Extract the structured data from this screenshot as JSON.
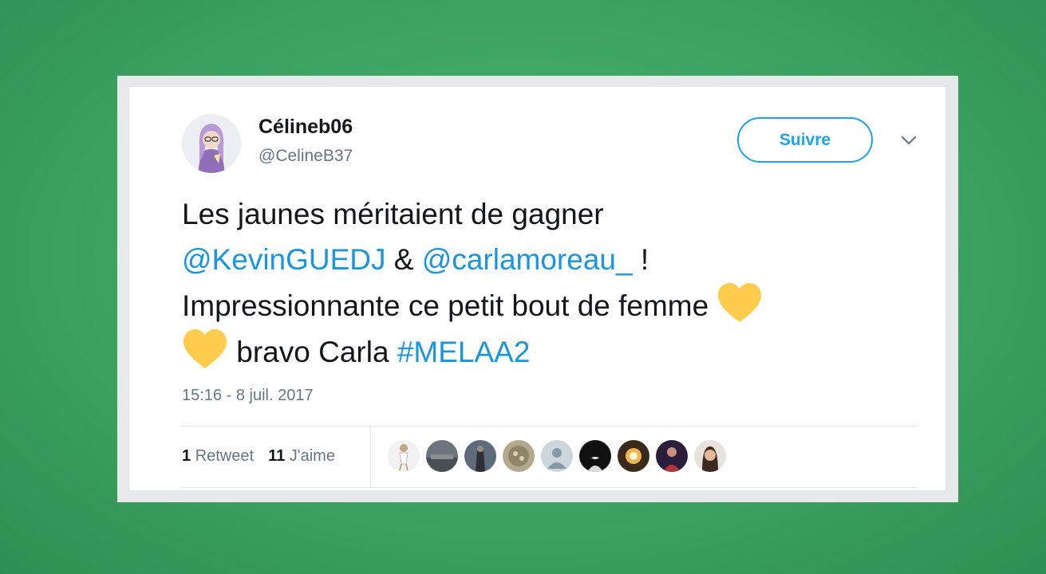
{
  "user": {
    "display_name": "Célineb06",
    "handle": "@CelineB37"
  },
  "follow_label": "Suivre",
  "tweet": {
    "line1": "Les jaunes méritaient de gagner",
    "mention1": "@KevinGUEDJ",
    "amp": " & ",
    "mention2": "@carlamoreau_",
    "excl": " !",
    "line3": "Impressionnante ce petit bout de femme ",
    "bravo": " bravo Carla ",
    "hashtag": "#MELAA2"
  },
  "timestamp": "15:16 - 8 juil. 2017",
  "stats": {
    "retweets_count": "1",
    "retweets_label": "Retweet",
    "likes_count": "11",
    "likes_label": "J'aime"
  },
  "colors": {
    "link": "#1b95e0",
    "heart": "#ffcc4d",
    "follow": "#1da1f2"
  },
  "icons": {
    "caret": "chevron-down-icon",
    "heart": "yellow-heart-emoji"
  }
}
